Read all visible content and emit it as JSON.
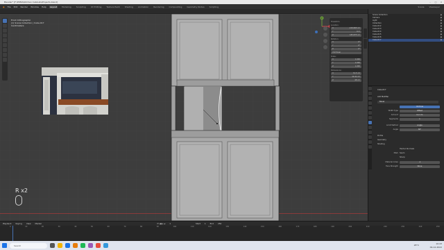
{
  "window": {
    "title": "Blender* [F:\\PDMA\\Kitchen Cabinets\\Projects.blend]"
  },
  "menubar": {
    "menus": [
      "File",
      "Edit",
      "Render",
      "Window",
      "Help"
    ],
    "workspaces": [
      "Layout",
      "Modeling",
      "Sculpting",
      "UV Editing",
      "Texture Paint",
      "Shading",
      "Animation",
      "Rendering",
      "Compositing",
      "Geometry Nodes",
      "Scripting"
    ],
    "active_workspace": "Layout",
    "scene": "Scene",
    "view_layer": "ViewLayer"
  },
  "viewport": {
    "overlay_lines": [
      "Front Orthographic",
      "(1) Scene Collection | Cube.017",
      "Centimeters"
    ],
    "key_hint": "R x2",
    "gizmo_axes": [
      "X",
      "Y",
      "Z"
    ]
  },
  "npanel": {
    "sections": [
      {
        "label": "Transform",
        "rows": []
      },
      {
        "label": "Location:",
        "rows": [
          [
            "X",
            "-109.665 cm"
          ],
          [
            "Y",
            "0 m"
          ],
          [
            "Z",
            "185.875 cm"
          ]
        ]
      },
      {
        "label": "Rotation:",
        "rows": [
          [
            "X",
            "0°"
          ],
          [
            "Y",
            "0°"
          ],
          [
            "Z",
            "0°"
          ]
        ]
      },
      {
        "label": "XYZ Euler",
        "rows": []
      },
      {
        "label": "Scale:",
        "rows": [
          [
            "X",
            "1.000"
          ],
          [
            "Y",
            "1.000"
          ],
          [
            "Z",
            "1.000"
          ]
        ]
      },
      {
        "label": "Dimensions:",
        "rows": [
          [
            "X",
            "31.5 cm"
          ],
          [
            "Y",
            "34.41 cm"
          ],
          [
            "Z",
            "48 cm"
          ]
        ]
      }
    ],
    "tabs": [
      "Item",
      "Tool",
      "View"
    ]
  },
  "outliner": {
    "rows": [
      {
        "name": "Scene Collection",
        "selected": false
      },
      {
        "name": "Camera",
        "selected": false
      },
      {
        "name": "Light",
        "selected": false
      },
      {
        "name": "Collection",
        "selected": false
      },
      {
        "name": "Cube.012",
        "selected": false
      },
      {
        "name": "Cube.013",
        "selected": false
      },
      {
        "name": "Cube.014",
        "selected": false
      },
      {
        "name": "Cube.015",
        "selected": false
      },
      {
        "name": "Cube.016",
        "selected": false
      },
      {
        "name": "Cube.017",
        "selected": true
      }
    ]
  },
  "properties": {
    "object": "Cube.017",
    "modifier": "Bevel",
    "add_modifier": "Add Modifier",
    "rows": [
      {
        "label": "",
        "value": "Vertices",
        "highlight": false
      },
      {
        "label": "Width Type",
        "value": "Offset",
        "highlight": false
      },
      {
        "label": "Amount",
        "value": "0.2 cm",
        "highlight": false
      },
      {
        "label": "Segments",
        "value": "1",
        "highlight": false
      },
      {
        "label": "Limit Method",
        "value": "Angle",
        "highlight": false
      },
      {
        "label": "Angle",
        "value": "30°",
        "highlight": false
      }
    ],
    "sections": [
      "Profile",
      "Geometry",
      "Shading"
    ],
    "shading_rows": [
      {
        "label": "",
        "value": "Harden Normals"
      },
      {
        "label": "Mark",
        "value": "Seam"
      },
      {
        "label": "",
        "value": "Sharp"
      },
      {
        "label": "Material Index",
        "value": "-1"
      },
      {
        "label": "Face Strength",
        "value": "None"
      }
    ]
  },
  "timeline": {
    "menus": [
      "Playback",
      "Keying",
      "View",
      "Marker"
    ],
    "start_label": "Start",
    "start": "1",
    "end_label": "End",
    "end": "250",
    "current_frame": "1",
    "ticks": [
      "0",
      "10",
      "20",
      "30",
      "40",
      "50",
      "60",
      "70",
      "80",
      "90",
      "100",
      "110",
      "120",
      "130",
      "140",
      "150",
      "160",
      "170",
      "180",
      "190",
      "200",
      "210",
      "220",
      "230",
      "240",
      "250"
    ]
  },
  "taskbar": {
    "search_placeholder": "Search",
    "temperature": "28°C",
    "time": "10:43",
    "date": "09-12-2022"
  },
  "colors": {
    "accent": "#4772b3",
    "viewport_bg": "#3d3d3d",
    "selection": "#ffffff"
  }
}
